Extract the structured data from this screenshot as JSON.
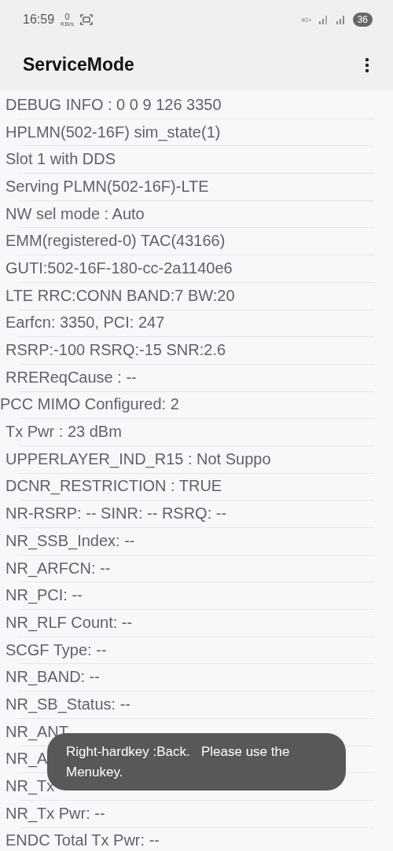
{
  "status_bar": {
    "time": "16:59",
    "speed_value": "0",
    "speed_unit": "KB/s",
    "network": "4G+",
    "battery": "36"
  },
  "app_bar": {
    "title": "ServiceMode"
  },
  "rows": [
    {
      "text": "DEBUG INFO : 0 0 9 126 3350",
      "kind": "normal"
    },
    {
      "text": "HPLMN(502-16F) sim_state(1)",
      "kind": "normal"
    },
    {
      "text": "Slot 1 with DDS",
      "kind": "normal"
    },
    {
      "text": "Serving PLMN(502-16F)-LTE",
      "kind": "normal"
    },
    {
      "text": "NW sel mode : Auto",
      "kind": "normal"
    },
    {
      "text": "EMM(registered-0) TAC(43166)",
      "kind": "normal"
    },
    {
      "text": "GUTI:502-16F-180-cc-2a1140e6",
      "kind": "normal"
    },
    {
      "text": "LTE RRC:CONN BAND:7 BW:20",
      "kind": "normal"
    },
    {
      "text": "Earfcn: 3350, PCI: 247",
      "kind": "normal"
    },
    {
      "text": "RSRP:-100 RSRQ:-15 SNR:2.6",
      "kind": "normal"
    },
    {
      "text": "RREReqCause : --",
      "kind": "normal"
    },
    {
      "text": "PCC MIMO Configured: 2",
      "kind": "flush"
    },
    {
      "text": "Tx Pwr : 23 dBm",
      "kind": "normal"
    },
    {
      "text": "UPPERLAYER_IND_R15 : Not Suppo",
      "kind": "normal"
    },
    {
      "text": "DCNR_RESTRICTION : TRUE",
      "kind": "normal"
    },
    {
      "text": "NR-RSRP: -- SINR: -- RSRQ: --",
      "kind": "normal"
    },
    {
      "text": "NR_SSB_Index: --",
      "kind": "normal"
    },
    {
      "text": "NR_ARFCN: --",
      "kind": "normal"
    },
    {
      "text": "NR_PCI: --",
      "kind": "normal"
    },
    {
      "text": "NR_RLF Count: --",
      "kind": "normal"
    },
    {
      "text": "SCGF Type: --",
      "kind": "normal"
    },
    {
      "text": "NR_BAND: --",
      "kind": "normal"
    },
    {
      "text": "NR_SB_Status: --",
      "kind": "normal"
    },
    {
      "text": "NR_ANT",
      "kind": "normal"
    },
    {
      "text": "NR_A",
      "kind": "normal"
    },
    {
      "text": "NR_Tx",
      "kind": "normal"
    },
    {
      "text": "NR_Tx Pwr: --",
      "kind": "normal"
    },
    {
      "text": "ENDC Total Tx Pwr: --",
      "kind": "normal"
    }
  ],
  "toast": {
    "text": "Right-hardkey :Back.   Please use the Menukey."
  }
}
